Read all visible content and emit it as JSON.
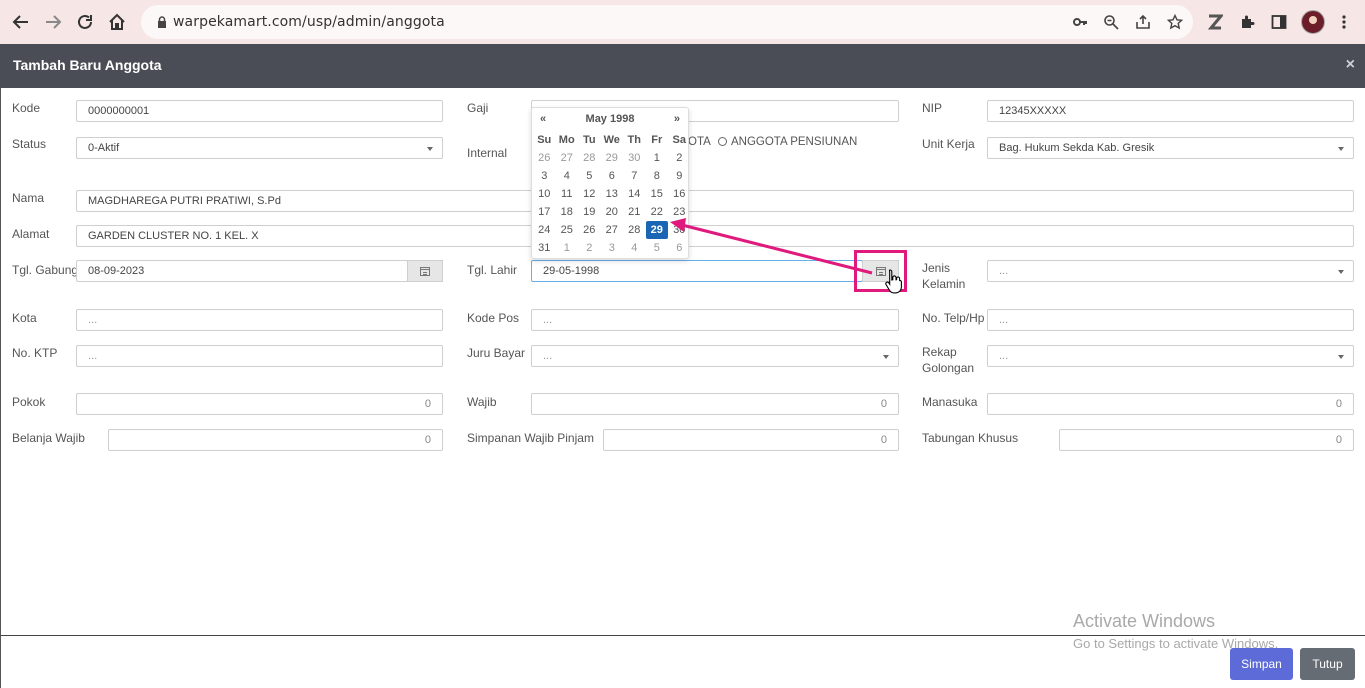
{
  "browser": {
    "url": "warpekamart.com/usp/admin/anggota"
  },
  "modal": {
    "title": "Tambah Baru Anggota",
    "close_symbol": "×"
  },
  "form": {
    "kode": {
      "label": "Kode",
      "value": "0000000001"
    },
    "gaji": {
      "label": "Gaji",
      "value": ""
    },
    "nip": {
      "label": "NIP",
      "value": "12345XXXXX"
    },
    "status": {
      "label": "Status",
      "value": "0-Aktif"
    },
    "internal": {
      "label": "Internal",
      "option1": "ANGGOTA",
      "option1_visible": "OTA",
      "option2": "ANGGOTA PENSIUNAN"
    },
    "unit_kerja": {
      "label": "Unit Kerja",
      "value": "Bag. Hukum Sekda Kab. Gresik"
    },
    "nama": {
      "label": "Nama",
      "value": "MAGDHAREGA PUTRI PRATIWI, S.Pd"
    },
    "alamat": {
      "label": "Alamat",
      "value": "GARDEN CLUSTER NO. 1 KEL. X"
    },
    "tgl_gabung": {
      "label": "Tgl. Gabung",
      "value": "08-09-2023"
    },
    "tgl_lahir": {
      "label": "Tgl. Lahir",
      "value": "29-05-1998"
    },
    "jenis_kelamin": {
      "label_line1": "Jenis",
      "label_line2": "Kelamin",
      "value": "..."
    },
    "kota": {
      "label": "Kota",
      "placeholder": "..."
    },
    "kode_pos": {
      "label": "Kode Pos",
      "placeholder": "..."
    },
    "telp": {
      "label": "No. Telp/Hp",
      "placeholder": "..."
    },
    "ktp": {
      "label": "No. KTP",
      "placeholder": "..."
    },
    "juru_bayar": {
      "label": "Juru Bayar",
      "value": "..."
    },
    "rekap_golongan": {
      "label_line1": "Rekap",
      "label_line2": "Golongan",
      "value": "..."
    },
    "pokok": {
      "label": "Pokok",
      "value": "0"
    },
    "wajib": {
      "label": "Wajib",
      "value": "0"
    },
    "manasuka": {
      "label": "Manasuka",
      "value": "0"
    },
    "belanja_wajib": {
      "label": "Belanja Wajib",
      "value": "0"
    },
    "simpanan_wajib_pinjam": {
      "label": "Simpanan Wajib Pinjam",
      "value": "0"
    },
    "tabungan_khusus": {
      "label": "Tabungan Khusus",
      "value": "0"
    }
  },
  "datepicker": {
    "prev": "«",
    "next": "»",
    "title": "May 1998",
    "days_of_week": [
      "Su",
      "Mo",
      "Tu",
      "We",
      "Th",
      "Fr",
      "Sa"
    ],
    "weeks": [
      [
        "26",
        "27",
        "28",
        "29",
        "30",
        "1",
        "2"
      ],
      [
        "3",
        "4",
        "5",
        "6",
        "7",
        "8",
        "9"
      ],
      [
        "10",
        "11",
        "12",
        "13",
        "14",
        "15",
        "16"
      ],
      [
        "17",
        "18",
        "19",
        "20",
        "21",
        "22",
        "23"
      ],
      [
        "24",
        "25",
        "26",
        "27",
        "28",
        "29",
        "30"
      ],
      [
        "31",
        "1",
        "2",
        "3",
        "4",
        "5",
        "6"
      ]
    ],
    "selected": "29"
  },
  "footer": {
    "save_label": "Simpan",
    "close_label": "Tutup"
  },
  "watermark": {
    "line1": "Activate Windows",
    "line2": "Go to Settings to activate Windows."
  },
  "colors": {
    "header_bg": "#4a4d55",
    "save_button": "#5c6bd8",
    "close_button": "#666c74",
    "selected_day": "#1a66b5",
    "annotation": "#e0197d"
  }
}
